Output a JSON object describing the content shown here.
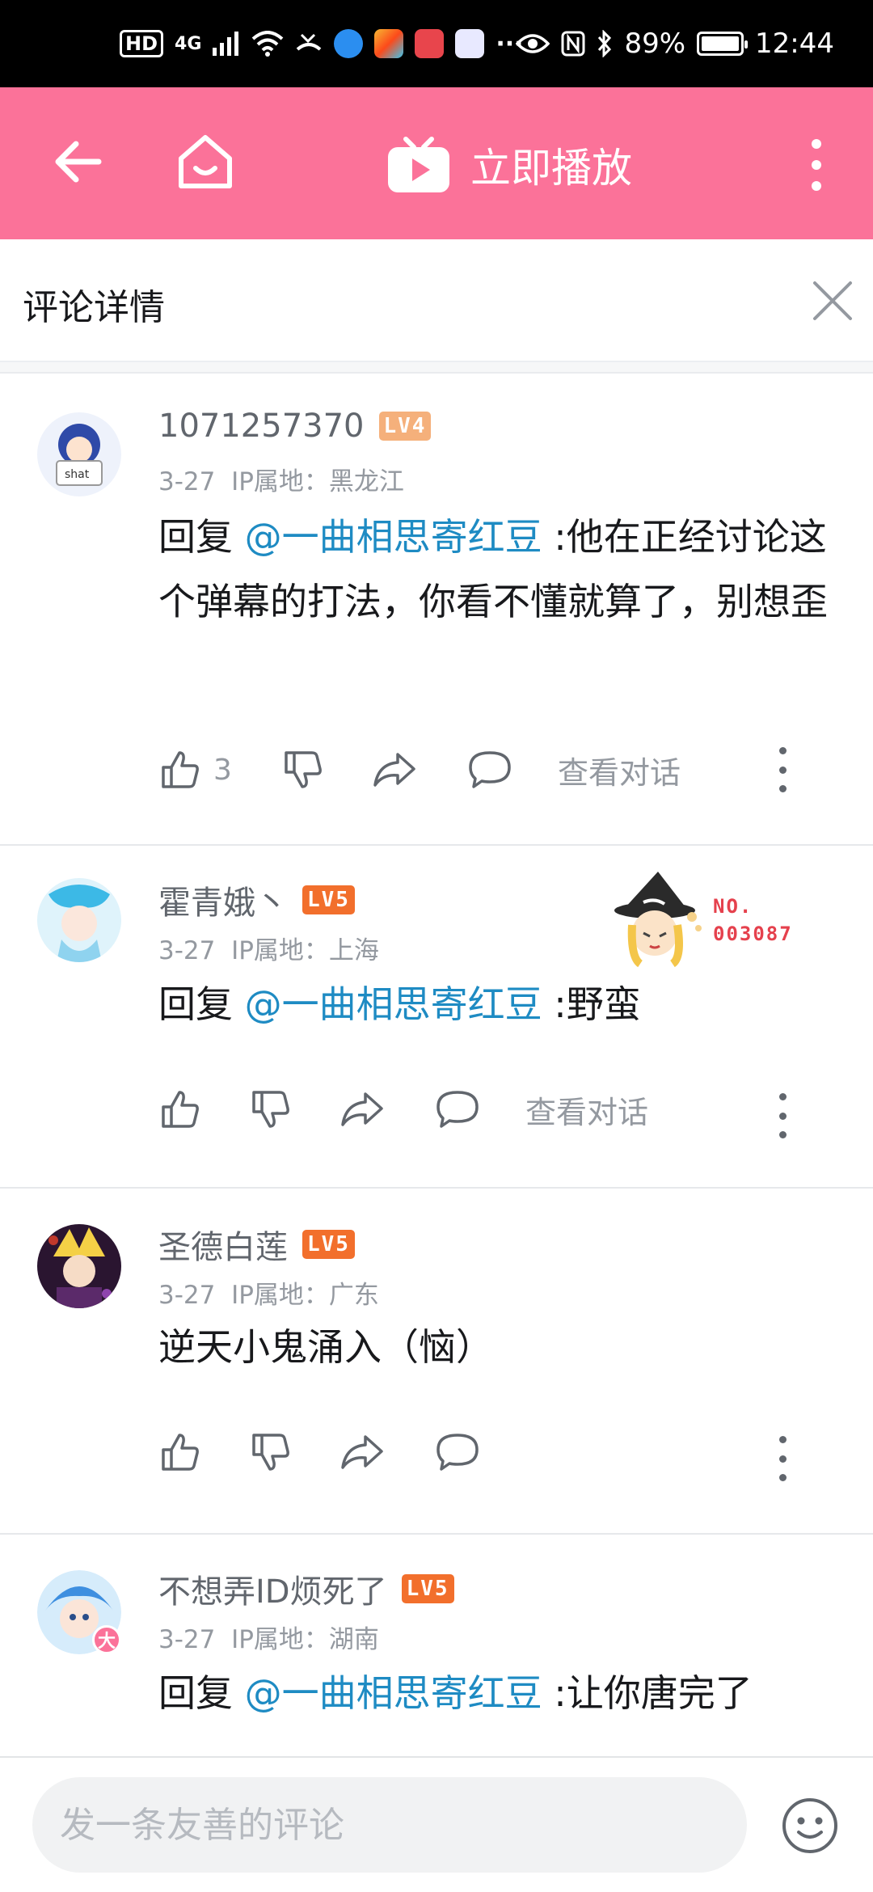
{
  "status_bar": {
    "hd": "HD",
    "network": "4G",
    "battery": "89%",
    "battery_level": 0.89,
    "time": "12:44"
  },
  "top_bar": {
    "play_now": "立即播放"
  },
  "panel": {
    "title": "评论详情"
  },
  "colors": {
    "brand_pink": "#fb7299",
    "mention_blue": "#1e8bc3",
    "lv4": "#f5b07b",
    "lv5": "#f26f2c"
  },
  "comments": [
    {
      "username": "1071257370",
      "level": "LV4",
      "date": "3-27",
      "ip": "IP属地：黑龙江",
      "reply_prefix": "回复 ",
      "mention": "@一曲相思寄红豆",
      "text": " :他在正经讨论这个弹幕的打法，你看不懂就算了，别想歪",
      "like_count": "3",
      "view_dialog": "查看对话"
    },
    {
      "username": "霍青娥丶",
      "level": "LV5",
      "date": "3-27",
      "ip": "IP属地：上海",
      "reply_prefix": "回复 ",
      "mention": "@一曲相思寄红豆",
      "text": " :野蛮",
      "like_count": "",
      "view_dialog": "查看对话",
      "badge_no_label": "NO.",
      "badge_no_value": "003087"
    },
    {
      "username": "圣德白莲",
      "level": "LV5",
      "date": "3-27",
      "ip": "IP属地：广东",
      "text": "逆天小鬼涌入（恼）"
    },
    {
      "username": "不想弄ID烦死了",
      "level": "LV5",
      "date": "3-27",
      "ip": "IP属地：湖南",
      "reply_prefix": "回复 ",
      "mention": "@一曲相思寄红豆",
      "text": " :让你唐完了",
      "avatar_badge": "大"
    }
  ],
  "input": {
    "placeholder": "发一条友善的评论"
  }
}
